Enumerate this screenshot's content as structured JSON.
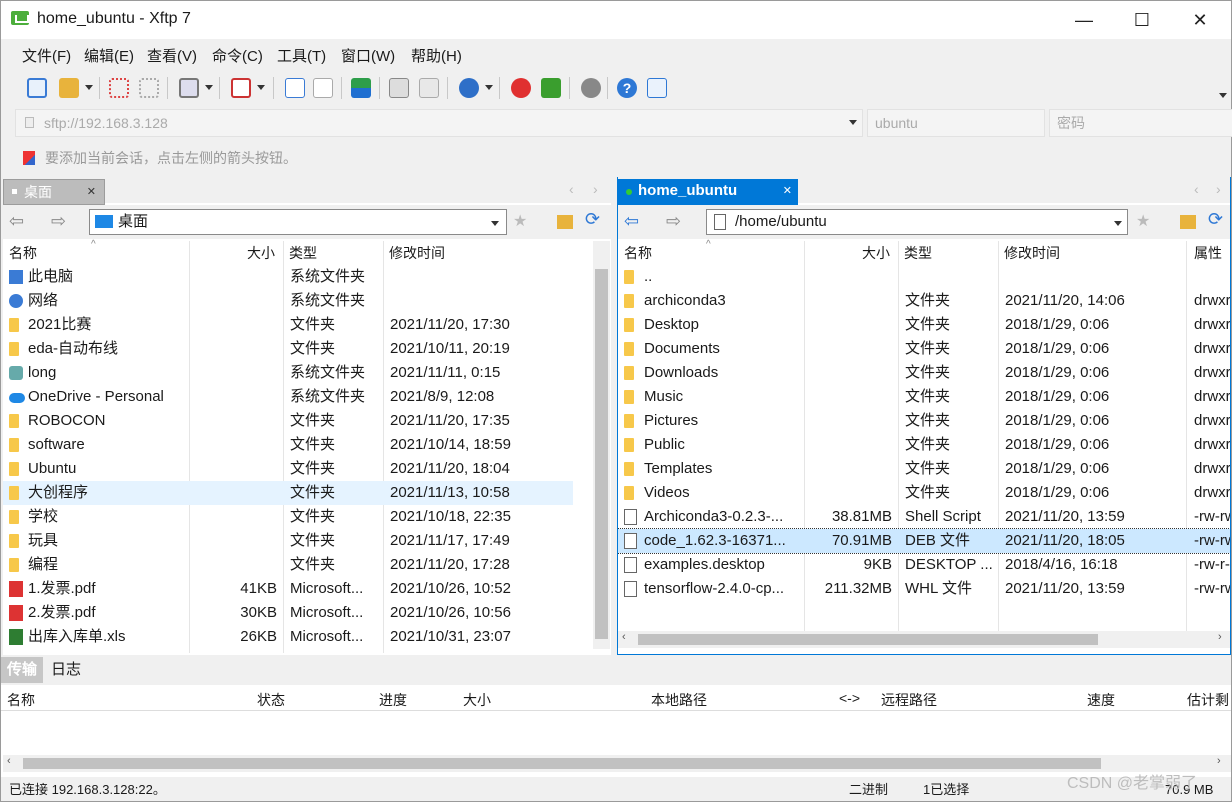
{
  "window": {
    "title": "home_ubuntu - Xftp 7",
    "minimize": "—",
    "maximize": "☐",
    "close": "✕"
  },
  "menu": [
    "文件(F)",
    "编辑(E)",
    "查看(V)",
    "命令(C)",
    "工具(T)",
    "窗口(W)",
    "帮助(H)"
  ],
  "address": {
    "host": "sftp://192.168.3.128",
    "user_placeholder": "ubuntu",
    "password_placeholder": "密码"
  },
  "hint": "要添加当前会话，点击左侧的箭头按钮。",
  "left": {
    "tab": "桌面",
    "path": "桌面",
    "columns": [
      "名称",
      "大小",
      "类型",
      "修改时间"
    ],
    "rows": [
      {
        "icon": "computer-icon",
        "name": "此电脑",
        "size": "",
        "type": "系统文件夹",
        "mtime": ""
      },
      {
        "icon": "network-icon",
        "name": "网络",
        "size": "",
        "type": "系统文件夹",
        "mtime": ""
      },
      {
        "icon": "folder-icon",
        "name": "2021比赛",
        "size": "",
        "type": "文件夹",
        "mtime": "2021/11/20, 17:30"
      },
      {
        "icon": "folder-icon",
        "name": "eda-自动布线",
        "size": "",
        "type": "文件夹",
        "mtime": "2021/10/11, 20:19"
      },
      {
        "icon": "user-icon",
        "name": "long",
        "size": "",
        "type": "系统文件夹",
        "mtime": "2021/11/11, 0:15"
      },
      {
        "icon": "onedrive-icon",
        "name": "OneDrive - Personal",
        "size": "",
        "type": "系统文件夹",
        "mtime": "2021/8/9, 12:08"
      },
      {
        "icon": "folder-icon",
        "name": "ROBOCON",
        "size": "",
        "type": "文件夹",
        "mtime": "2021/11/20, 17:35"
      },
      {
        "icon": "folder-icon",
        "name": "software",
        "size": "",
        "type": "文件夹",
        "mtime": "2021/10/14, 18:59"
      },
      {
        "icon": "folder-icon",
        "name": "Ubuntu",
        "size": "",
        "type": "文件夹",
        "mtime": "2021/11/20, 18:04"
      },
      {
        "icon": "folder-icon",
        "name": "大创程序",
        "size": "",
        "type": "文件夹",
        "mtime": "2021/11/13, 10:58"
      },
      {
        "icon": "folder-icon",
        "name": "学校",
        "size": "",
        "type": "文件夹",
        "mtime": "2021/10/18, 22:35"
      },
      {
        "icon": "folder-icon",
        "name": "玩具",
        "size": "",
        "type": "文件夹",
        "mtime": "2021/11/17, 17:49"
      },
      {
        "icon": "folder-icon",
        "name": "编程",
        "size": "",
        "type": "文件夹",
        "mtime": "2021/11/20, 17:28"
      },
      {
        "icon": "pdf-icon",
        "name": "1.发票.pdf",
        "size": "41KB",
        "type": "Microsoft...",
        "mtime": "2021/10/26, 10:52"
      },
      {
        "icon": "pdf-icon",
        "name": "2.发票.pdf",
        "size": "30KB",
        "type": "Microsoft...",
        "mtime": "2021/10/26, 10:56"
      },
      {
        "icon": "xls-icon",
        "name": "出库入库单.xls",
        "size": "26KB",
        "type": "Microsoft...",
        "mtime": "2021/10/31, 23:07"
      }
    ]
  },
  "right": {
    "tab": "home_ubuntu",
    "path": "/home/ubuntu",
    "columns": [
      "名称",
      "大小",
      "类型",
      "修改时间",
      "属性"
    ],
    "rows": [
      {
        "icon": "folder-icon",
        "name": "..",
        "size": "",
        "type": "",
        "mtime": "",
        "attr": ""
      },
      {
        "icon": "folder-icon",
        "name": "archiconda3",
        "size": "",
        "type": "文件夹",
        "mtime": "2021/11/20, 14:06",
        "attr": "drwxr"
      },
      {
        "icon": "folder-icon",
        "name": "Desktop",
        "size": "",
        "type": "文件夹",
        "mtime": "2018/1/29, 0:06",
        "attr": "drwxr"
      },
      {
        "icon": "folder-icon",
        "name": "Documents",
        "size": "",
        "type": "文件夹",
        "mtime": "2018/1/29, 0:06",
        "attr": "drwxr"
      },
      {
        "icon": "folder-icon",
        "name": "Downloads",
        "size": "",
        "type": "文件夹",
        "mtime": "2018/1/29, 0:06",
        "attr": "drwxr"
      },
      {
        "icon": "folder-icon",
        "name": "Music",
        "size": "",
        "type": "文件夹",
        "mtime": "2018/1/29, 0:06",
        "attr": "drwxr"
      },
      {
        "icon": "folder-icon",
        "name": "Pictures",
        "size": "",
        "type": "文件夹",
        "mtime": "2018/1/29, 0:06",
        "attr": "drwxr"
      },
      {
        "icon": "folder-icon",
        "name": "Public",
        "size": "",
        "type": "文件夹",
        "mtime": "2018/1/29, 0:06",
        "attr": "drwxr"
      },
      {
        "icon": "folder-icon",
        "name": "Templates",
        "size": "",
        "type": "文件夹",
        "mtime": "2018/1/29, 0:06",
        "attr": "drwxr"
      },
      {
        "icon": "folder-icon",
        "name": "Videos",
        "size": "",
        "type": "文件夹",
        "mtime": "2018/1/29, 0:06",
        "attr": "drwxr"
      },
      {
        "icon": "script-icon",
        "name": "Archiconda3-0.2.3-...",
        "size": "38.81MB",
        "type": "Shell Script",
        "mtime": "2021/11/20, 13:59",
        "attr": "-rw-rw"
      },
      {
        "icon": "file-icon",
        "name": "code_1.62.3-16371...",
        "size": "70.91MB",
        "type": "DEB 文件",
        "mtime": "2021/11/20, 18:05",
        "attr": "-rw-rw"
      },
      {
        "icon": "file-icon",
        "name": "examples.desktop",
        "size": "9KB",
        "type": "DESKTOP ...",
        "mtime": "2018/4/16, 16:18",
        "attr": "-rw-r-"
      },
      {
        "icon": "file-icon",
        "name": "tensorflow-2.4.0-cp...",
        "size": "211.32MB",
        "type": "WHL 文件",
        "mtime": "2021/11/20, 13:59",
        "attr": "-rw-rw"
      }
    ]
  },
  "transfer": {
    "tabs": [
      "传输",
      "日志"
    ],
    "columns": [
      "名称",
      "状态",
      "进度",
      "大小",
      "本地路径",
      "<->",
      "远程路径",
      "速度",
      "估计剩"
    ]
  },
  "status": {
    "left": "已连接 192.168.3.128:22。",
    "mode": "二进制",
    "selection": "1已选择",
    "size": "70.9 MB"
  },
  "watermark": "CSDN @老掌弱了",
  "colors": {
    "accent": "#0078d7",
    "selected": "#cce8ff"
  }
}
